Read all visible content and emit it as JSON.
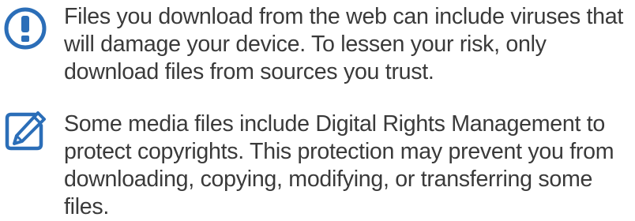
{
  "notices": [
    {
      "type": "warning",
      "icon": "exclamation-icon",
      "icon_color": "#2b6eb8",
      "text": "Files you download from the web can include viruses that will damage your device. To lessen your risk, only download files from sources you trust."
    },
    {
      "type": "note",
      "icon": "pencil-note-icon",
      "icon_color": "#2b6eb8",
      "text": "Some media files include Digital Rights Management to protect copyrights. This protection may prevent you from downloading, copying, modifying, or transferring some files."
    }
  ]
}
